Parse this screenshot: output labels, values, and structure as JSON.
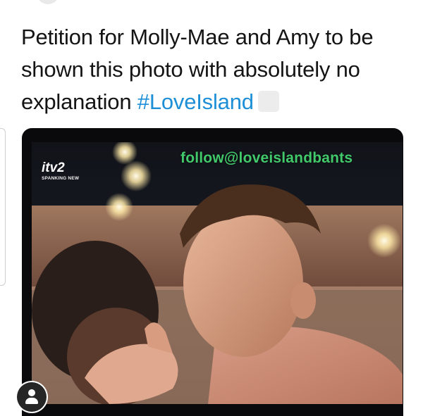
{
  "tweet": {
    "text_main": "Petition for Molly-Mae and Amy to be shown this photo with absolutely no explanation",
    "hashtag": "#LoveIsland"
  },
  "photo": {
    "watermark": "follow@loveislandbants",
    "channel_logo": "itv2",
    "channel_tagline": "SPANKING NEW"
  },
  "icons": {
    "emoji": "emoji-placeholder",
    "user_badge": "user-tag-icon"
  },
  "colors": {
    "hashtag": "#1d8fd6",
    "watermark": "#42c96b"
  }
}
